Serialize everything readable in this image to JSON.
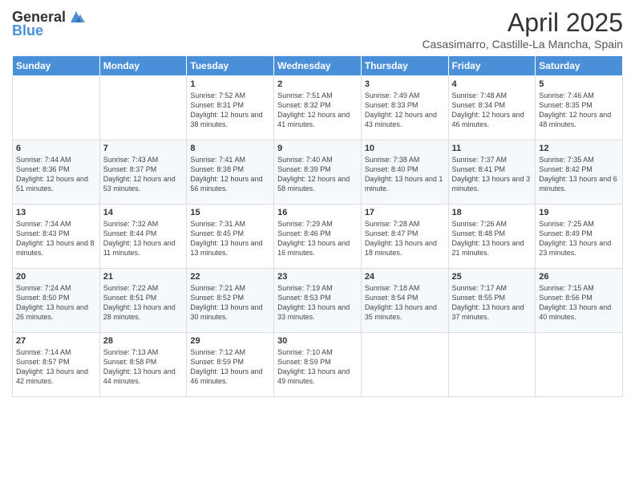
{
  "header": {
    "logo_general": "General",
    "logo_blue": "Blue",
    "month_title": "April 2025",
    "location": "Casasimarro, Castille-La Mancha, Spain"
  },
  "days_of_week": [
    "Sunday",
    "Monday",
    "Tuesday",
    "Wednesday",
    "Thursday",
    "Friday",
    "Saturday"
  ],
  "weeks": [
    [
      {
        "day": "",
        "info": ""
      },
      {
        "day": "",
        "info": ""
      },
      {
        "day": "1",
        "info": "Sunrise: 7:52 AM\nSunset: 8:31 PM\nDaylight: 12 hours and 38 minutes."
      },
      {
        "day": "2",
        "info": "Sunrise: 7:51 AM\nSunset: 8:32 PM\nDaylight: 12 hours and 41 minutes."
      },
      {
        "day": "3",
        "info": "Sunrise: 7:49 AM\nSunset: 8:33 PM\nDaylight: 12 hours and 43 minutes."
      },
      {
        "day": "4",
        "info": "Sunrise: 7:48 AM\nSunset: 8:34 PM\nDaylight: 12 hours and 46 minutes."
      },
      {
        "day": "5",
        "info": "Sunrise: 7:46 AM\nSunset: 8:35 PM\nDaylight: 12 hours and 48 minutes."
      }
    ],
    [
      {
        "day": "6",
        "info": "Sunrise: 7:44 AM\nSunset: 8:36 PM\nDaylight: 12 hours and 51 minutes."
      },
      {
        "day": "7",
        "info": "Sunrise: 7:43 AM\nSunset: 8:37 PM\nDaylight: 12 hours and 53 minutes."
      },
      {
        "day": "8",
        "info": "Sunrise: 7:41 AM\nSunset: 8:38 PM\nDaylight: 12 hours and 56 minutes."
      },
      {
        "day": "9",
        "info": "Sunrise: 7:40 AM\nSunset: 8:39 PM\nDaylight: 12 hours and 58 minutes."
      },
      {
        "day": "10",
        "info": "Sunrise: 7:38 AM\nSunset: 8:40 PM\nDaylight: 13 hours and 1 minute."
      },
      {
        "day": "11",
        "info": "Sunrise: 7:37 AM\nSunset: 8:41 PM\nDaylight: 13 hours and 3 minutes."
      },
      {
        "day": "12",
        "info": "Sunrise: 7:35 AM\nSunset: 8:42 PM\nDaylight: 13 hours and 6 minutes."
      }
    ],
    [
      {
        "day": "13",
        "info": "Sunrise: 7:34 AM\nSunset: 8:43 PM\nDaylight: 13 hours and 8 minutes."
      },
      {
        "day": "14",
        "info": "Sunrise: 7:32 AM\nSunset: 8:44 PM\nDaylight: 13 hours and 11 minutes."
      },
      {
        "day": "15",
        "info": "Sunrise: 7:31 AM\nSunset: 8:45 PM\nDaylight: 13 hours and 13 minutes."
      },
      {
        "day": "16",
        "info": "Sunrise: 7:29 AM\nSunset: 8:46 PM\nDaylight: 13 hours and 16 minutes."
      },
      {
        "day": "17",
        "info": "Sunrise: 7:28 AM\nSunset: 8:47 PM\nDaylight: 13 hours and 18 minutes."
      },
      {
        "day": "18",
        "info": "Sunrise: 7:26 AM\nSunset: 8:48 PM\nDaylight: 13 hours and 21 minutes."
      },
      {
        "day": "19",
        "info": "Sunrise: 7:25 AM\nSunset: 8:49 PM\nDaylight: 13 hours and 23 minutes."
      }
    ],
    [
      {
        "day": "20",
        "info": "Sunrise: 7:24 AM\nSunset: 8:50 PM\nDaylight: 13 hours and 26 minutes."
      },
      {
        "day": "21",
        "info": "Sunrise: 7:22 AM\nSunset: 8:51 PM\nDaylight: 13 hours and 28 minutes."
      },
      {
        "day": "22",
        "info": "Sunrise: 7:21 AM\nSunset: 8:52 PM\nDaylight: 13 hours and 30 minutes."
      },
      {
        "day": "23",
        "info": "Sunrise: 7:19 AM\nSunset: 8:53 PM\nDaylight: 13 hours and 33 minutes."
      },
      {
        "day": "24",
        "info": "Sunrise: 7:18 AM\nSunset: 8:54 PM\nDaylight: 13 hours and 35 minutes."
      },
      {
        "day": "25",
        "info": "Sunrise: 7:17 AM\nSunset: 8:55 PM\nDaylight: 13 hours and 37 minutes."
      },
      {
        "day": "26",
        "info": "Sunrise: 7:15 AM\nSunset: 8:56 PM\nDaylight: 13 hours and 40 minutes."
      }
    ],
    [
      {
        "day": "27",
        "info": "Sunrise: 7:14 AM\nSunset: 8:57 PM\nDaylight: 13 hours and 42 minutes."
      },
      {
        "day": "28",
        "info": "Sunrise: 7:13 AM\nSunset: 8:58 PM\nDaylight: 13 hours and 44 minutes."
      },
      {
        "day": "29",
        "info": "Sunrise: 7:12 AM\nSunset: 8:59 PM\nDaylight: 13 hours and 46 minutes."
      },
      {
        "day": "30",
        "info": "Sunrise: 7:10 AM\nSunset: 8:59 PM\nDaylight: 13 hours and 49 minutes."
      },
      {
        "day": "",
        "info": ""
      },
      {
        "day": "",
        "info": ""
      },
      {
        "day": "",
        "info": ""
      }
    ]
  ]
}
